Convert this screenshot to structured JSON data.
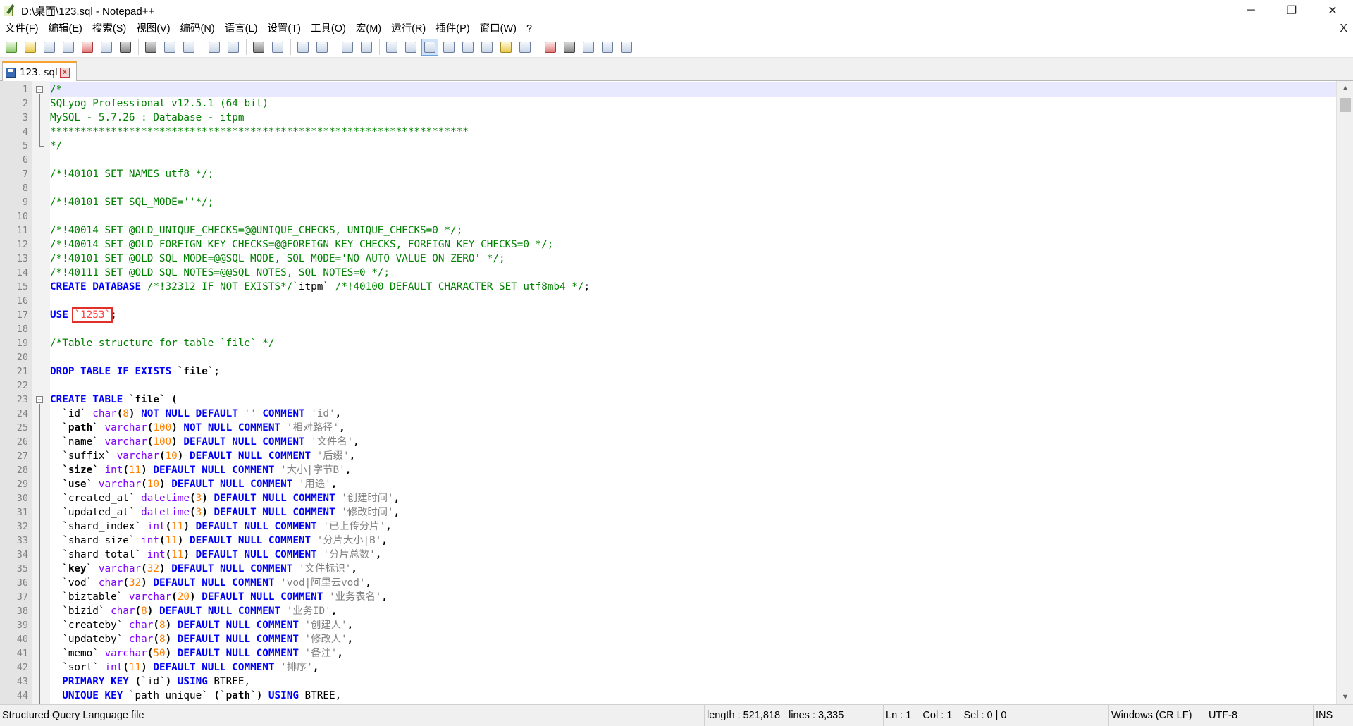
{
  "window": {
    "title": "D:\\桌面\\123.sql - Notepad++",
    "minimize_label": "─",
    "restore_label": "❐",
    "close_label": "✕"
  },
  "menu": {
    "items": [
      "文件(F)",
      "编辑(E)",
      "搜索(S)",
      "视图(V)",
      "编码(N)",
      "语言(L)",
      "设置(T)",
      "工具(O)",
      "宏(M)",
      "运行(R)",
      "插件(P)",
      "窗口(W)",
      "?"
    ],
    "close_label": "X"
  },
  "toolbar": {
    "icons": [
      "new-file-icon",
      "open-file-icon",
      "save-icon",
      "save-all-icon",
      "close-icon",
      "close-all-icon",
      "print-icon",
      "cut-icon",
      "copy-icon",
      "paste-icon",
      "undo-icon",
      "redo-icon",
      "find-icon",
      "replace-icon",
      "zoom-in-icon",
      "zoom-out-icon",
      "sync-vertical-icon",
      "sync-horizontal-icon",
      "word-wrap-icon",
      "show-all-chars-icon",
      "indent-guide-icon",
      "user-lang-icon",
      "doc-map-icon",
      "function-list-icon",
      "folder-workspace-icon",
      "monitoring-icon",
      "record-macro-icon",
      "stop-macro-icon",
      "play-macro-icon",
      "run-macro-multiple-icon",
      "save-macro-icon"
    ]
  },
  "tab": {
    "label": "123. sql",
    "close_label": "x"
  },
  "editor": {
    "lines": [
      [
        [
          "/*",
          "com"
        ]
      ],
      [
        [
          "SQLyog Professional v12.5.1 (64 bit)",
          "com"
        ]
      ],
      [
        [
          "MySQL - 5.7.26 : Database - itpm",
          "com"
        ]
      ],
      [
        [
          "*********************************************************************",
          "com"
        ]
      ],
      [
        [
          "*/",
          "com"
        ]
      ],
      [],
      [
        [
          "/*!40101 SET NAMES utf8 */;",
          "com"
        ]
      ],
      [],
      [
        [
          "/*!40101 SET SQL_MODE=''*/;",
          "com"
        ]
      ],
      [],
      [
        [
          "/*!40014 SET @OLD_UNIQUE_CHECKS=@@UNIQUE_CHECKS, UNIQUE_CHECKS=0 */;",
          "com"
        ]
      ],
      [
        [
          "/*!40014 SET @OLD_FOREIGN_KEY_CHECKS=@@FOREIGN_KEY_CHECKS, FOREIGN_KEY_CHECKS=0 */;",
          "com"
        ]
      ],
      [
        [
          "/*!40101 SET @OLD_SQL_MODE=@@SQL_MODE, SQL_MODE='NO_AUTO_VALUE_ON_ZERO' */;",
          "com"
        ]
      ],
      [
        [
          "/*!40111 SET @OLD_SQL_NOTES=@@SQL_NOTES, SQL_NOTES=0 */;",
          "com"
        ]
      ],
      [
        [
          "CREATE DATABASE",
          "kw"
        ],
        [
          " ",
          "id"
        ],
        [
          "/*!32312 IF NOT EXISTS*/",
          "com"
        ],
        [
          "`itpm` ",
          "id"
        ],
        [
          "/*!40100 DEFAULT CHARACTER SET utf8mb4 */",
          "com"
        ],
        [
          ";",
          "id"
        ]
      ],
      [],
      [
        [
          "USE",
          "kw"
        ],
        [
          " ",
          "id"
        ],
        [
          "`1253`",
          "red-box"
        ],
        [
          ";",
          "id"
        ]
      ],
      [],
      [
        [
          "/*Table structure for table `file` */",
          "com"
        ]
      ],
      [],
      [
        [
          "DROP TABLE IF EXISTS",
          "kw"
        ],
        [
          " ",
          "id"
        ],
        [
          "`file`",
          "bold"
        ],
        [
          ";",
          "id"
        ]
      ],
      [],
      [
        [
          "CREATE TABLE",
          "kw"
        ],
        [
          " ",
          "id"
        ],
        [
          "`file`",
          "bold"
        ],
        [
          " (",
          "bold"
        ]
      ],
      [
        [
          "  `id` ",
          "id"
        ],
        [
          "char",
          "type"
        ],
        [
          "(",
          "bold"
        ],
        [
          "8",
          "num"
        ],
        [
          ") ",
          "bold"
        ],
        [
          "NOT NULL DEFAULT",
          "kw"
        ],
        [
          " ",
          "id"
        ],
        [
          "''",
          "str"
        ],
        [
          " ",
          "id"
        ],
        [
          "COMMENT",
          "kw"
        ],
        [
          " ",
          "id"
        ],
        [
          "'id'",
          "str"
        ],
        [
          ",",
          "bold"
        ]
      ],
      [
        [
          "  ",
          "id"
        ],
        [
          "`path`",
          "bold"
        ],
        [
          " ",
          "id"
        ],
        [
          "varchar",
          "type"
        ],
        [
          "(",
          "bold"
        ],
        [
          "100",
          "num"
        ],
        [
          ") ",
          "bold"
        ],
        [
          "NOT NULL COMMENT",
          "kw"
        ],
        [
          " ",
          "id"
        ],
        [
          "'相对路径'",
          "str"
        ],
        [
          ",",
          "bold"
        ]
      ],
      [
        [
          "  `name` ",
          "id"
        ],
        [
          "varchar",
          "type"
        ],
        [
          "(",
          "bold"
        ],
        [
          "100",
          "num"
        ],
        [
          ") ",
          "bold"
        ],
        [
          "DEFAULT NULL COMMENT",
          "kw"
        ],
        [
          " ",
          "id"
        ],
        [
          "'文件名'",
          "str"
        ],
        [
          ",",
          "bold"
        ]
      ],
      [
        [
          "  `suffix` ",
          "id"
        ],
        [
          "varchar",
          "type"
        ],
        [
          "(",
          "bold"
        ],
        [
          "10",
          "num"
        ],
        [
          ") ",
          "bold"
        ],
        [
          "DEFAULT NULL COMMENT",
          "kw"
        ],
        [
          " ",
          "id"
        ],
        [
          "'后缀'",
          "str"
        ],
        [
          ",",
          "bold"
        ]
      ],
      [
        [
          "  ",
          "id"
        ],
        [
          "`size`",
          "bold"
        ],
        [
          " ",
          "id"
        ],
        [
          "int",
          "type"
        ],
        [
          "(",
          "bold"
        ],
        [
          "11",
          "num"
        ],
        [
          ") ",
          "bold"
        ],
        [
          "DEFAULT NULL COMMENT",
          "kw"
        ],
        [
          " ",
          "id"
        ],
        [
          "'大小|字节B'",
          "str"
        ],
        [
          ",",
          "bold"
        ]
      ],
      [
        [
          "  ",
          "id"
        ],
        [
          "`use`",
          "bold"
        ],
        [
          " ",
          "id"
        ],
        [
          "varchar",
          "type"
        ],
        [
          "(",
          "bold"
        ],
        [
          "10",
          "num"
        ],
        [
          ") ",
          "bold"
        ],
        [
          "DEFAULT NULL COMMENT",
          "kw"
        ],
        [
          " ",
          "id"
        ],
        [
          "'用途'",
          "str"
        ],
        [
          ",",
          "bold"
        ]
      ],
      [
        [
          "  `created_at` ",
          "id"
        ],
        [
          "datetime",
          "type"
        ],
        [
          "(",
          "bold"
        ],
        [
          "3",
          "num"
        ],
        [
          ") ",
          "bold"
        ],
        [
          "DEFAULT NULL COMMENT",
          "kw"
        ],
        [
          " ",
          "id"
        ],
        [
          "'创建时间'",
          "str"
        ],
        [
          ",",
          "bold"
        ]
      ],
      [
        [
          "  `updated_at` ",
          "id"
        ],
        [
          "datetime",
          "type"
        ],
        [
          "(",
          "bold"
        ],
        [
          "3",
          "num"
        ],
        [
          ") ",
          "bold"
        ],
        [
          "DEFAULT NULL COMMENT",
          "kw"
        ],
        [
          " ",
          "id"
        ],
        [
          "'修改时间'",
          "str"
        ],
        [
          ",",
          "bold"
        ]
      ],
      [
        [
          "  `shard_index` ",
          "id"
        ],
        [
          "int",
          "type"
        ],
        [
          "(",
          "bold"
        ],
        [
          "11",
          "num"
        ],
        [
          ") ",
          "bold"
        ],
        [
          "DEFAULT NULL COMMENT",
          "kw"
        ],
        [
          " ",
          "id"
        ],
        [
          "'已上传分片'",
          "str"
        ],
        [
          ",",
          "bold"
        ]
      ],
      [
        [
          "  `shard_size` ",
          "id"
        ],
        [
          "int",
          "type"
        ],
        [
          "(",
          "bold"
        ],
        [
          "11",
          "num"
        ],
        [
          ") ",
          "bold"
        ],
        [
          "DEFAULT NULL COMMENT",
          "kw"
        ],
        [
          " ",
          "id"
        ],
        [
          "'分片大小|B'",
          "str"
        ],
        [
          ",",
          "bold"
        ]
      ],
      [
        [
          "  `shard_total` ",
          "id"
        ],
        [
          "int",
          "type"
        ],
        [
          "(",
          "bold"
        ],
        [
          "11",
          "num"
        ],
        [
          ") ",
          "bold"
        ],
        [
          "DEFAULT NULL COMMENT",
          "kw"
        ],
        [
          " ",
          "id"
        ],
        [
          "'分片总数'",
          "str"
        ],
        [
          ",",
          "bold"
        ]
      ],
      [
        [
          "  ",
          "id"
        ],
        [
          "`key`",
          "bold"
        ],
        [
          " ",
          "id"
        ],
        [
          "varchar",
          "type"
        ],
        [
          "(",
          "bold"
        ],
        [
          "32",
          "num"
        ],
        [
          ") ",
          "bold"
        ],
        [
          "DEFAULT NULL COMMENT",
          "kw"
        ],
        [
          " ",
          "id"
        ],
        [
          "'文件标识'",
          "str"
        ],
        [
          ",",
          "bold"
        ]
      ],
      [
        [
          "  `vod` ",
          "id"
        ],
        [
          "char",
          "type"
        ],
        [
          "(",
          "bold"
        ],
        [
          "32",
          "num"
        ],
        [
          ") ",
          "bold"
        ],
        [
          "DEFAULT NULL COMMENT",
          "kw"
        ],
        [
          " ",
          "id"
        ],
        [
          "'vod|阿里云vod'",
          "str"
        ],
        [
          ",",
          "bold"
        ]
      ],
      [
        [
          "  `biztable` ",
          "id"
        ],
        [
          "varchar",
          "type"
        ],
        [
          "(",
          "bold"
        ],
        [
          "20",
          "num"
        ],
        [
          ") ",
          "bold"
        ],
        [
          "DEFAULT NULL COMMENT",
          "kw"
        ],
        [
          " ",
          "id"
        ],
        [
          "'业务表名'",
          "str"
        ],
        [
          ",",
          "bold"
        ]
      ],
      [
        [
          "  `bizid` ",
          "id"
        ],
        [
          "char",
          "type"
        ],
        [
          "(",
          "bold"
        ],
        [
          "8",
          "num"
        ],
        [
          ") ",
          "bold"
        ],
        [
          "DEFAULT NULL COMMENT",
          "kw"
        ],
        [
          " ",
          "id"
        ],
        [
          "'业务ID'",
          "str"
        ],
        [
          ",",
          "bold"
        ]
      ],
      [
        [
          "  `createby` ",
          "id"
        ],
        [
          "char",
          "type"
        ],
        [
          "(",
          "bold"
        ],
        [
          "8",
          "num"
        ],
        [
          ") ",
          "bold"
        ],
        [
          "DEFAULT NULL COMMENT",
          "kw"
        ],
        [
          " ",
          "id"
        ],
        [
          "'创建人'",
          "str"
        ],
        [
          ",",
          "bold"
        ]
      ],
      [
        [
          "  `updateby` ",
          "id"
        ],
        [
          "char",
          "type"
        ],
        [
          "(",
          "bold"
        ],
        [
          "8",
          "num"
        ],
        [
          ") ",
          "bold"
        ],
        [
          "DEFAULT NULL COMMENT",
          "kw"
        ],
        [
          " ",
          "id"
        ],
        [
          "'修改人'",
          "str"
        ],
        [
          ",",
          "bold"
        ]
      ],
      [
        [
          "  `memo` ",
          "id"
        ],
        [
          "varchar",
          "type"
        ],
        [
          "(",
          "bold"
        ],
        [
          "50",
          "num"
        ],
        [
          ") ",
          "bold"
        ],
        [
          "DEFAULT NULL COMMENT",
          "kw"
        ],
        [
          " ",
          "id"
        ],
        [
          "'备注'",
          "str"
        ],
        [
          ",",
          "bold"
        ]
      ],
      [
        [
          "  `sort` ",
          "id"
        ],
        [
          "int",
          "type"
        ],
        [
          "(",
          "bold"
        ],
        [
          "11",
          "num"
        ],
        [
          ") ",
          "bold"
        ],
        [
          "DEFAULT NULL COMMENT",
          "kw"
        ],
        [
          " ",
          "id"
        ],
        [
          "'排序'",
          "str"
        ],
        [
          ",",
          "bold"
        ]
      ],
      [
        [
          "  ",
          "id"
        ],
        [
          "PRIMARY KEY",
          "kw"
        ],
        [
          " (",
          "bold"
        ],
        [
          "`id`",
          "id"
        ],
        [
          ") ",
          "bold"
        ],
        [
          "USING",
          "kw"
        ],
        [
          " BTREE,",
          "id"
        ]
      ],
      [
        [
          "  ",
          "id"
        ],
        [
          "UNIQUE KEY",
          "kw"
        ],
        [
          " ",
          "id"
        ],
        [
          "`path_unique`",
          "id"
        ],
        [
          " (",
          "bold"
        ],
        [
          "`path`",
          "bold"
        ],
        [
          ") ",
          "bold"
        ],
        [
          "USING",
          "kw"
        ],
        [
          " BTREE,",
          "id"
        ]
      ]
    ]
  },
  "status": {
    "file_type": "Structured Query Language file",
    "length": "length : 521,818",
    "lines": "lines : 3,335",
    "ln": "Ln : 1",
    "col": "Col : 1",
    "sel": "Sel : 0 | 0",
    "eol": "Windows (CR LF)",
    "encoding": "UTF-8",
    "mode": "INS"
  },
  "colors": {
    "comment": "#008000",
    "keyword": "#0000ff",
    "string": "#808080",
    "number": "#ff8000",
    "type": "#8000ff",
    "highlight_box": "#e0302a",
    "tab_accent": "#f9a12f"
  }
}
